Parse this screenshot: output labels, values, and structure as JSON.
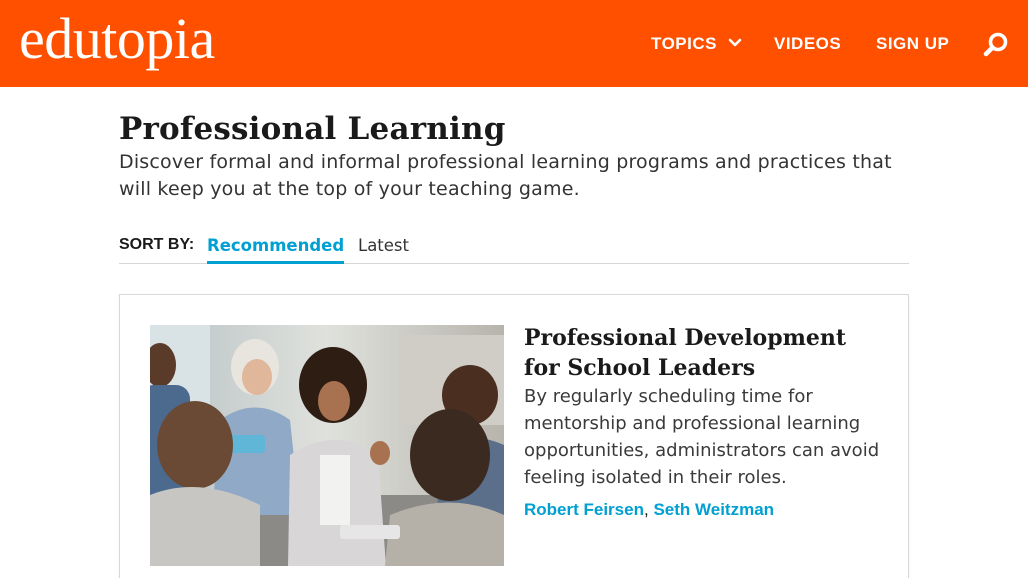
{
  "header": {
    "logo_text": "edutopia",
    "nav": {
      "topics_label": "TOPICS",
      "videos_label": "VIDEOS",
      "signup_label": "SIGN UP"
    },
    "brand_color": "#ff5000",
    "search_icon": "search-icon"
  },
  "page": {
    "title": "Professional Learning",
    "description": "Discover formal and informal professional learning programs and practices that will keep you at the top of your teaching game."
  },
  "sort": {
    "label": "SORT BY:",
    "tabs": [
      {
        "label": "Recommended",
        "active": true
      },
      {
        "label": "Latest",
        "active": false
      }
    ],
    "accent_color": "#00a0d2"
  },
  "articles": [
    {
      "title": "Professional Development for School Leaders",
      "summary": "By regularly scheduling time for mentorship and professional learning opportunities, administrators can avoid feeling isolated in their roles.",
      "authors": [
        "Robert Feirsen",
        "Seth Weitzman"
      ],
      "author_separator": ","
    }
  ]
}
